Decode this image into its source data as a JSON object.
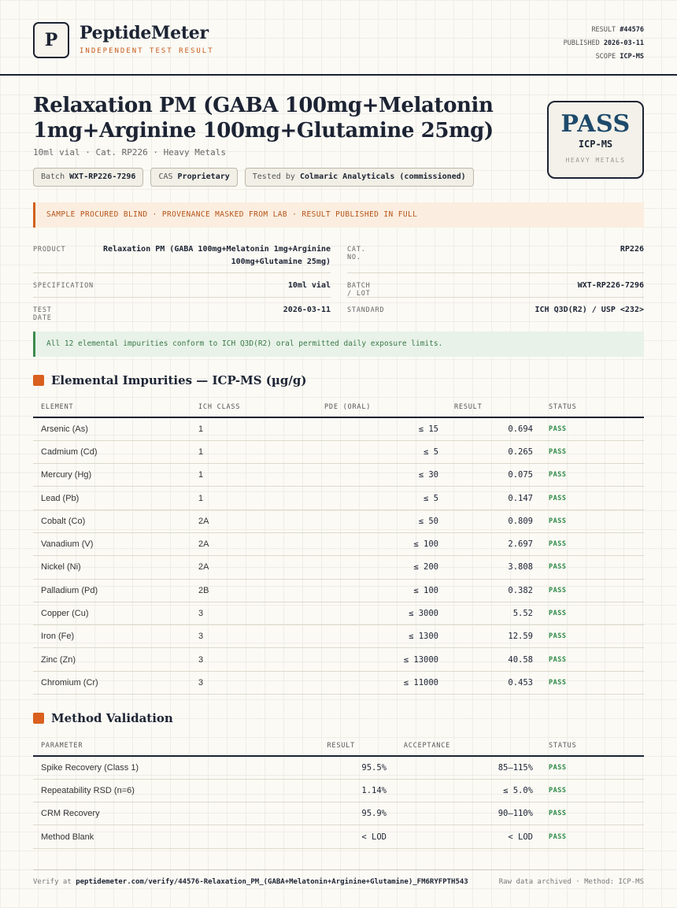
{
  "header": {
    "logo_letter": "P",
    "brand": "PeptideMeter",
    "brand_sub": "INDEPENDENT TEST RESULT",
    "result_label": "RESULT",
    "result_value": "#44576",
    "published_label": "PUBLISHED",
    "published_value": "2026-03-11",
    "scope_label": "SCOPE",
    "scope_value": "ICP-MS"
  },
  "product": {
    "title": "Relaxation PM (GABA 100mg+Melatonin 1mg+Arginine 100mg+Glutamine 25mg)",
    "subtitle": "10ml vial · Cat. RP226 · Heavy Metals",
    "chips": [
      {
        "label": "Batch",
        "value": "WXT-RP226-7296"
      },
      {
        "label": "CAS",
        "value": "Proprietary"
      },
      {
        "label": "Tested by",
        "value": "Colmaric Analyticals (commissioned)"
      }
    ]
  },
  "badge": {
    "status": "PASS",
    "method": "ICP-MS",
    "scope": "HEAVY METALS"
  },
  "notice": "SAMPLE PROCURED BLIND · PROVENANCE MASKED FROM LAB · RESULT PUBLISHED IN FULL",
  "info": {
    "product_label": "PRODUCT",
    "product_value": "Relaxation PM (GABA 100mg+Melatonin 1mg+Arginine 100mg+Glutamine 25mg)",
    "cat_label": "CAT. NO.",
    "cat_value": "RP226",
    "spec_label": "SPECIFICATION",
    "spec_value": "10ml vial",
    "batch_label": "BATCH / LOT",
    "batch_value": "WXT-RP226-7296",
    "date_label": "TEST DATE",
    "date_value": "2026-03-11",
    "standard_label": "STANDARD",
    "standard_value": "ICH Q3D(R2) / USP <232>"
  },
  "conformance": "All 12 elemental impurities conform to ICH Q3D(R2) oral permitted daily exposure limits.",
  "impurities": {
    "title": "Elemental Impurities — ICP-MS (µg/g)",
    "headers": [
      "ELEMENT",
      "ICH CLASS",
      "PDE (ORAL)",
      "RESULT",
      "STATUS"
    ],
    "rows": [
      {
        "element": "Arsenic (As)",
        "cls": "1",
        "pde": "≤ 15",
        "result": "0.694",
        "status": "PASS"
      },
      {
        "element": "Cadmium (Cd)",
        "cls": "1",
        "pde": "≤ 5",
        "result": "0.265",
        "status": "PASS"
      },
      {
        "element": "Mercury (Hg)",
        "cls": "1",
        "pde": "≤ 30",
        "result": "0.075",
        "status": "PASS"
      },
      {
        "element": "Lead (Pb)",
        "cls": "1",
        "pde": "≤ 5",
        "result": "0.147",
        "status": "PASS"
      },
      {
        "element": "Cobalt (Co)",
        "cls": "2A",
        "pde": "≤ 50",
        "result": "0.809",
        "status": "PASS"
      },
      {
        "element": "Vanadium (V)",
        "cls": "2A",
        "pde": "≤ 100",
        "result": "2.697",
        "status": "PASS"
      },
      {
        "element": "Nickel (Ni)",
        "cls": "2A",
        "pde": "≤ 200",
        "result": "3.808",
        "status": "PASS"
      },
      {
        "element": "Palladium (Pd)",
        "cls": "2B",
        "pde": "≤ 100",
        "result": "0.382",
        "status": "PASS"
      },
      {
        "element": "Copper (Cu)",
        "cls": "3",
        "pde": "≤ 3000",
        "result": "5.52",
        "status": "PASS"
      },
      {
        "element": "Iron (Fe)",
        "cls": "3",
        "pde": "≤ 1300",
        "result": "12.59",
        "status": "PASS"
      },
      {
        "element": "Zinc (Zn)",
        "cls": "3",
        "pde": "≤ 13000",
        "result": "40.58",
        "status": "PASS"
      },
      {
        "element": "Chromium (Cr)",
        "cls": "3",
        "pde": "≤ 11000",
        "result": "0.453",
        "status": "PASS"
      }
    ]
  },
  "validation": {
    "title": "Method Validation",
    "headers": [
      "PARAMETER",
      "RESULT",
      "ACCEPTANCE",
      "STATUS"
    ],
    "rows": [
      {
        "param": "Spike Recovery (Class 1)",
        "result": "95.5%",
        "acceptance": "85–115%",
        "status": "PASS"
      },
      {
        "param": "Repeatability RSD (n=6)",
        "result": "1.14%",
        "acceptance": "≤ 5.0%",
        "status": "PASS"
      },
      {
        "param": "CRM Recovery",
        "result": "95.9%",
        "acceptance": "90–110%",
        "status": "PASS"
      },
      {
        "param": "Method Blank",
        "result": "< LOD",
        "acceptance": "< LOD",
        "status": "PASS"
      }
    ]
  },
  "footer": {
    "verify_prefix": "Verify at",
    "verify_url": "peptidemeter.com/verify/44576-Relaxation_PM_(GABA+Melatonin+Arginine+Glutamine)_FM6RYFPTH543",
    "right": "Raw data archived · Method: ICP-MS"
  }
}
